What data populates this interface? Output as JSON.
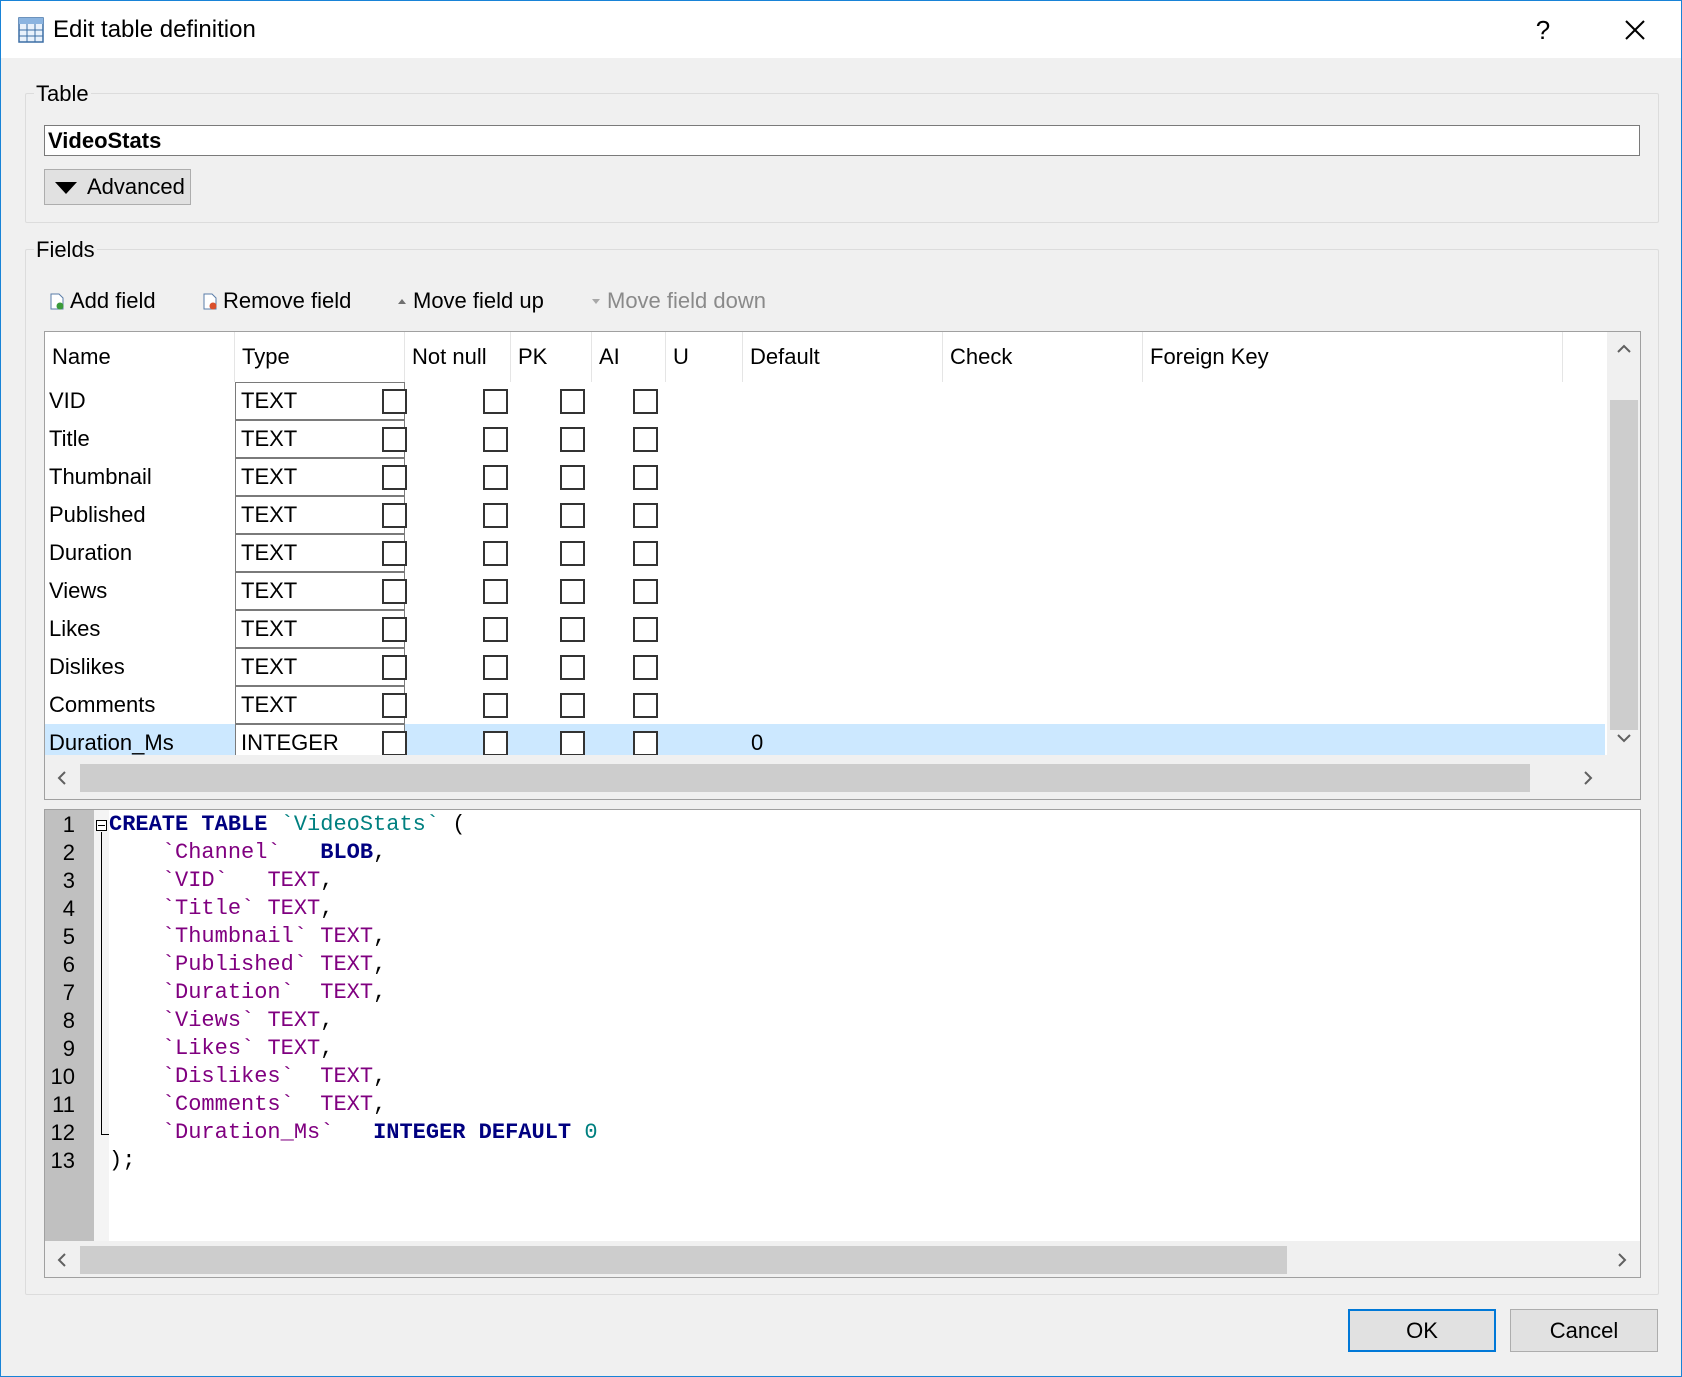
{
  "window": {
    "title": "Edit table definition",
    "help_label": "?"
  },
  "table_group": {
    "label": "Table",
    "name_value": "VideoStats",
    "advanced_label": "Advanced"
  },
  "fields_group": {
    "label": "Fields",
    "toolbar": {
      "add_field": "Add field",
      "remove_field": "Remove field",
      "move_up": "Move field up",
      "move_down": "Move field down"
    },
    "columns": [
      "Name",
      "Type",
      "Not null",
      "PK",
      "AI",
      "U",
      "Default",
      "Check",
      "Foreign Key"
    ],
    "rows": [
      {
        "name": "VID",
        "type": "TEXT",
        "default": ""
      },
      {
        "name": "Title",
        "type": "TEXT",
        "default": ""
      },
      {
        "name": "Thumbnail",
        "type": "TEXT",
        "default": ""
      },
      {
        "name": "Published",
        "type": "TEXT",
        "default": ""
      },
      {
        "name": "Duration",
        "type": "TEXT",
        "default": ""
      },
      {
        "name": "Views",
        "type": "TEXT",
        "default": ""
      },
      {
        "name": "Likes",
        "type": "TEXT",
        "default": ""
      },
      {
        "name": "Dislikes",
        "type": "TEXT",
        "default": ""
      },
      {
        "name": "Comments",
        "type": "TEXT",
        "default": ""
      },
      {
        "name": "Duration_Ms",
        "type": "INTEGER",
        "default": "0"
      }
    ],
    "selected_row": 9
  },
  "sql_editor": {
    "line_numbers": [
      "1",
      "2",
      "3",
      "4",
      "5",
      "6",
      "7",
      "8",
      "9",
      "10",
      "11",
      "12",
      "13"
    ],
    "lines": [
      [
        {
          "t": "CREATE TABLE ",
          "c": "kw"
        },
        {
          "t": "`VideoStats`",
          "c": "tbl"
        },
        {
          "t": " (",
          "c": "pl"
        }
      ],
      [
        {
          "t": "    ",
          "c": "pl"
        },
        {
          "t": "`Channel`",
          "c": "id"
        },
        {
          "t": "   ",
          "c": "pl"
        },
        {
          "t": "BLOB",
          "c": "kw"
        },
        {
          "t": ",",
          "c": "pl"
        }
      ],
      [
        {
          "t": "    ",
          "c": "pl"
        },
        {
          "t": "`VID`",
          "c": "id"
        },
        {
          "t": "   ",
          "c": "pl"
        },
        {
          "t": "TEXT",
          "c": "ty"
        },
        {
          "t": ",",
          "c": "pl"
        }
      ],
      [
        {
          "t": "    ",
          "c": "pl"
        },
        {
          "t": "`Title`",
          "c": "id"
        },
        {
          "t": " ",
          "c": "pl"
        },
        {
          "t": "TEXT",
          "c": "ty"
        },
        {
          "t": ",",
          "c": "pl"
        }
      ],
      [
        {
          "t": "    ",
          "c": "pl"
        },
        {
          "t": "`Thumbnail`",
          "c": "id"
        },
        {
          "t": " ",
          "c": "pl"
        },
        {
          "t": "TEXT",
          "c": "ty"
        },
        {
          "t": ",",
          "c": "pl"
        }
      ],
      [
        {
          "t": "    ",
          "c": "pl"
        },
        {
          "t": "`Published`",
          "c": "id"
        },
        {
          "t": " ",
          "c": "pl"
        },
        {
          "t": "TEXT",
          "c": "ty"
        },
        {
          "t": ",",
          "c": "pl"
        }
      ],
      [
        {
          "t": "    ",
          "c": "pl"
        },
        {
          "t": "`Duration`",
          "c": "id"
        },
        {
          "t": "  ",
          "c": "pl"
        },
        {
          "t": "TEXT",
          "c": "ty"
        },
        {
          "t": ",",
          "c": "pl"
        }
      ],
      [
        {
          "t": "    ",
          "c": "pl"
        },
        {
          "t": "`Views`",
          "c": "id"
        },
        {
          "t": " ",
          "c": "pl"
        },
        {
          "t": "TEXT",
          "c": "ty"
        },
        {
          "t": ",",
          "c": "pl"
        }
      ],
      [
        {
          "t": "    ",
          "c": "pl"
        },
        {
          "t": "`Likes`",
          "c": "id"
        },
        {
          "t": " ",
          "c": "pl"
        },
        {
          "t": "TEXT",
          "c": "ty"
        },
        {
          "t": ",",
          "c": "pl"
        }
      ],
      [
        {
          "t": "    ",
          "c": "pl"
        },
        {
          "t": "`Dislikes`",
          "c": "id"
        },
        {
          "t": "  ",
          "c": "pl"
        },
        {
          "t": "TEXT",
          "c": "ty"
        },
        {
          "t": ",",
          "c": "pl"
        }
      ],
      [
        {
          "t": "    ",
          "c": "pl"
        },
        {
          "t": "`Comments`",
          "c": "id"
        },
        {
          "t": "  ",
          "c": "pl"
        },
        {
          "t": "TEXT",
          "c": "ty"
        },
        {
          "t": ",",
          "c": "pl"
        }
      ],
      [
        {
          "t": "    ",
          "c": "pl"
        },
        {
          "t": "`Duration_Ms`",
          "c": "id"
        },
        {
          "t": "   ",
          "c": "pl"
        },
        {
          "t": "INTEGER DEFAULT",
          "c": "kw"
        },
        {
          "t": " ",
          "c": "pl"
        },
        {
          "t": "0",
          "c": "num"
        }
      ],
      [
        {
          "t": ");",
          "c": "pl"
        }
      ]
    ]
  },
  "buttons": {
    "ok": "OK",
    "cancel": "Cancel"
  },
  "icons": [
    "table-icon",
    "help-icon",
    "close-icon",
    "triangle-down-icon",
    "add-field-icon",
    "remove-field-icon",
    "arrow-up-icon",
    "arrow-down-icon",
    "chevron-down-icon",
    "scroll-up-icon",
    "scroll-down-icon",
    "scroll-left-icon",
    "scroll-right-icon",
    "fold-minus-icon"
  ],
  "colors": {
    "window_border": "#1883d7",
    "selection": "#cce8ff",
    "sql_keyword": "#000080",
    "sql_table": "#008080",
    "sql_identifier": "#800080",
    "default_button_border": "#0078d7"
  }
}
